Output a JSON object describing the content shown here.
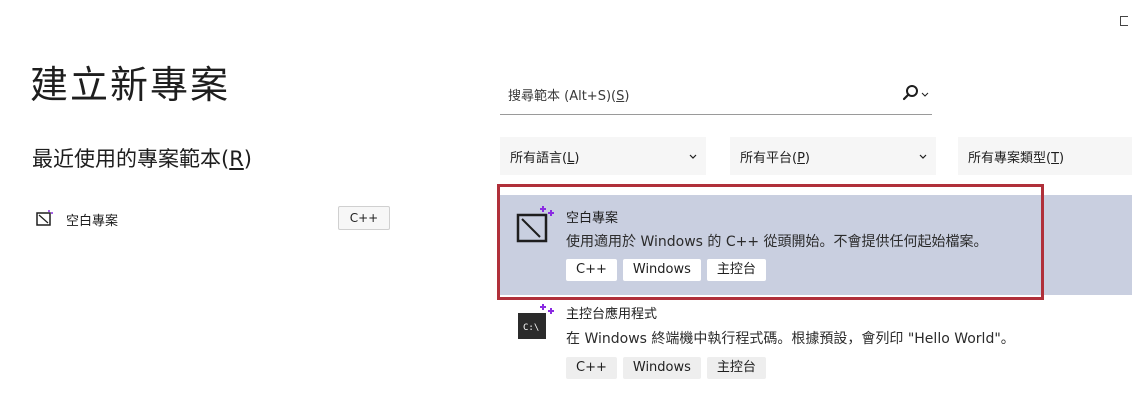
{
  "page": {
    "title": "建立新專案"
  },
  "recent": {
    "title": "最近使用的專案範本(",
    "title_key": "R",
    "title_suffix": ")",
    "items": [
      {
        "label": "空白專案",
        "tag": "C++",
        "icon": "empty-project-icon"
      }
    ]
  },
  "search": {
    "placeholder_prefix": "搜尋範本 (Alt+S)(",
    "placeholder_key": "S",
    "placeholder_suffix": ")",
    "icon": "search-icon"
  },
  "filters": {
    "language": {
      "prefix": "所有語言(",
      "key": "L",
      "suffix": ")"
    },
    "platform": {
      "prefix": "所有平台(",
      "key": "P",
      "suffix": ")"
    },
    "project_type": {
      "prefix": "所有專案類型(",
      "key": "T",
      "suffix": ")"
    }
  },
  "templates": [
    {
      "title": "空白專案",
      "description": "使用適用於 Windows 的 C++ 從頭開始。不會提供任何起始檔案。",
      "tags": [
        "C++",
        "Windows",
        "主控台"
      ],
      "selected": true,
      "icon": "empty-project-icon"
    },
    {
      "title": "主控台應用程式",
      "description": "在 Windows 終端機中執行程式碼。根據預設，會列印 \"Hello World\"。",
      "tags": [
        "C++",
        "Windows",
        "主控台"
      ],
      "selected": false,
      "icon": "console-app-icon"
    }
  ],
  "colors": {
    "selected_bg": "#c9cfe0",
    "highlight_outline": "#b0303a",
    "icon_accent": "#8a2be2"
  }
}
